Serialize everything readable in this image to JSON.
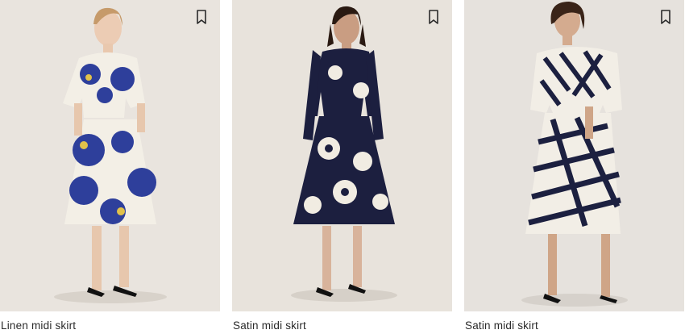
{
  "products": [
    {
      "title": "Linen midi skirt",
      "bookmark_icon": "bookmark-icon",
      "pattern": "blue-yellow large floral print",
      "colors": {
        "bg": "#e9e4de",
        "base": "#f3efe6",
        "print": "#2e3f9b",
        "accent": "#e1c14a"
      }
    },
    {
      "title": "Satin midi skirt",
      "bookmark_icon": "bookmark-icon",
      "pattern": "navy floral print",
      "colors": {
        "bg": "#e8e3dc",
        "base": "#1c1f3f",
        "print": "#f1ece2",
        "accent": "#1c1f3f"
      }
    },
    {
      "title": "Satin midi skirt",
      "bookmark_icon": "bookmark-icon",
      "pattern": "navy and cream geometric stripes",
      "colors": {
        "bg": "#e6e2dd",
        "base": "#f2eee6",
        "print": "#1c2040",
        "accent": "#1c2040"
      }
    }
  ]
}
